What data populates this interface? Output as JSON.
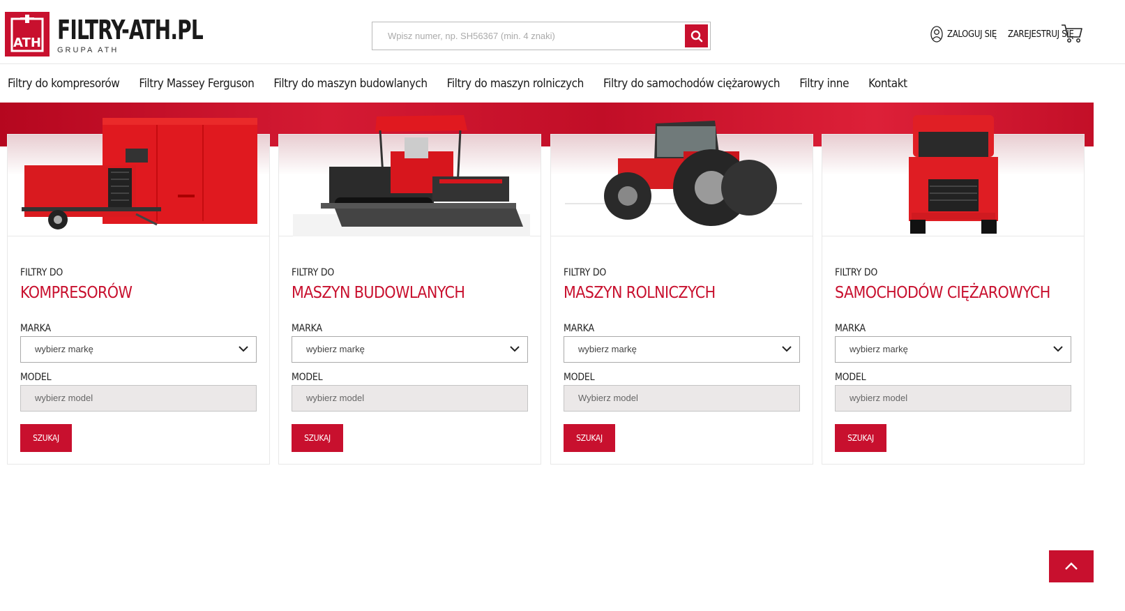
{
  "header": {
    "logo_mark": "ATH",
    "logo_text": "FILTRY-ATH.PL",
    "logo_sub": "GRUPA ATH",
    "search_placeholder": "Wpisz numer, np. SH56367 (min. 4 znaki)",
    "login_label": "ZALOGUJ SIĘ",
    "register_label": "ZAREJESTRUJ SIĘ"
  },
  "nav": {
    "items": [
      "Filtry do kompresorów",
      "Filtry Massey Ferguson",
      "Filtry do maszyn budowlanych",
      "Filtry do maszyn rolniczych",
      "Filtry do samochodów ciężarowych",
      "Filtry inne",
      "Kontakt"
    ]
  },
  "cards": [
    {
      "pre": "FILTRY DO",
      "title": "KOMPRESORÓW",
      "brand_label": "MARKA",
      "brand_value": "wybierz markę",
      "model_label": "MODEL",
      "model_value": "wybierz model",
      "button": "SZUKAJ"
    },
    {
      "pre": "FILTRY DO",
      "title": "MASZYN BUDOWLANYCH",
      "brand_label": "MARKA",
      "brand_value": "wybierz markę",
      "model_label": "MODEL",
      "model_value": "wybierz model",
      "button": "SZUKAJ"
    },
    {
      "pre": "FILTRY DO",
      "title": "MASZYN ROLNICZYCH",
      "brand_label": "MARKA",
      "brand_value": "wybierz markę",
      "model_label": "MODEL",
      "model_value": "Wybierz model",
      "button": "SZUKAJ"
    },
    {
      "pre": "FILTRY DO",
      "title": "SAMOCHODÓW CIĘŻAROWYCH",
      "brand_label": "MARKA",
      "brand_value": "wybierz markę",
      "model_label": "MODEL",
      "model_value": "wybierz model",
      "button": "SZUKAJ"
    }
  ],
  "colors": {
    "brand_red": "#c8102e",
    "model_bg": "#ebe8e8"
  },
  "icons": {
    "search": "search-icon",
    "user": "user-icon",
    "cart": "cart-icon",
    "chevron": "chevron-down-icon",
    "top": "chevron-up-icon"
  }
}
